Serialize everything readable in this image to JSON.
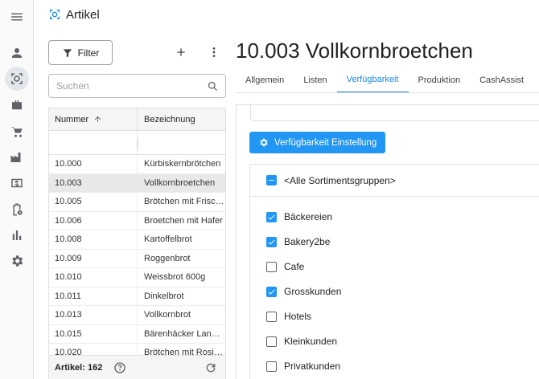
{
  "app": {
    "title": "Artikel"
  },
  "left": {
    "filter_label": "Filter",
    "search_placeholder": "Suchen",
    "columns": [
      "Nummer",
      "Bezeichnung"
    ],
    "rows": [
      [
        "10.000",
        "Kürbiskernbrötchen"
      ],
      [
        "10.003",
        "Vollkornbroetchen"
      ],
      [
        "10.005",
        "Brötchen mit Frischkäse"
      ],
      [
        "10.006",
        "Broetchen mit Hafer"
      ],
      [
        "10.008",
        "Kartoffelbrot"
      ],
      [
        "10.009",
        "Roggenbrot"
      ],
      [
        "10.010",
        "Weissbrot 600g"
      ],
      [
        "10.011",
        "Dinkelbrot"
      ],
      [
        "10.013",
        "Vollkornbrot"
      ],
      [
        "10.015",
        "Bärenhäcker Landbrot"
      ],
      [
        "10.020",
        "Brötchen mit Rosinen"
      ]
    ],
    "selected_index": 1,
    "footer_count": "Artikel: 162"
  },
  "detail": {
    "title": "10.003 Vollkornbroetchen",
    "tabs": [
      "Allgemein",
      "Listen",
      "Verfügbarkeit",
      "Produktion",
      "CashAssist"
    ],
    "active_tab": 2,
    "availability_button": "Verfügbarkeit Einstellung",
    "all_groups_label": "<Alle Sortimentsgruppen>",
    "groups": [
      {
        "label": "Bäckereien",
        "checked": true
      },
      {
        "label": "Bakery2be",
        "checked": true
      },
      {
        "label": "Cafe",
        "checked": false
      },
      {
        "label": "Grosskunden",
        "checked": true
      },
      {
        "label": "Hotels",
        "checked": false
      },
      {
        "label": "Kleinkunden",
        "checked": false
      },
      {
        "label": "Privatkunden",
        "checked": false
      }
    ]
  },
  "colors": {
    "accent": "#2196f3",
    "tab_active": "#1e88e5",
    "selected_row": "#e8e8e8"
  }
}
